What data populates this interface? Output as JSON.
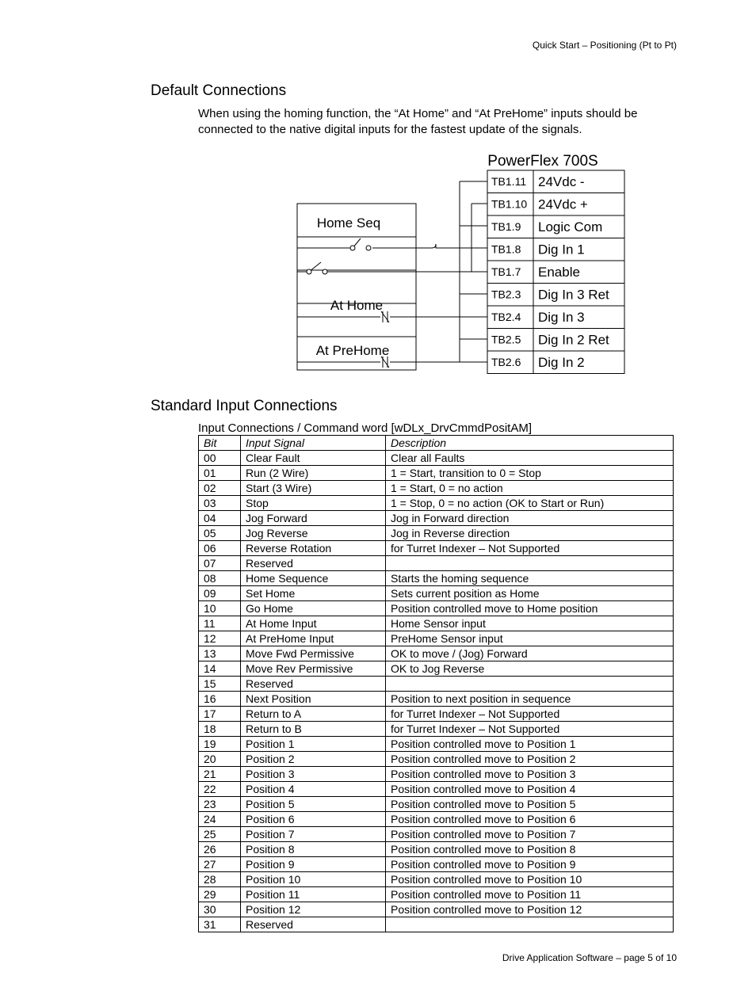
{
  "header": {
    "right": "Quick Start – Positioning (Pt to Pt)"
  },
  "sections": {
    "default_connections": "Default Connections",
    "standard_input": "Standard Input Connections"
  },
  "intro": "When using the homing function, the “At Home” and “At PreHome” inputs should be connected to the native digital inputs for the fastest update of the signals.",
  "diagram": {
    "title": "PowerFlex 700S",
    "labels": {
      "home_seq": "Home Seq",
      "at_home": "At Home",
      "at_prehome": "At PreHome"
    },
    "terminals": [
      {
        "code": "TB1.11",
        "name": "24Vdc -"
      },
      {
        "code": "TB1.10",
        "name": "24Vdc +"
      },
      {
        "code": "TB1.9",
        "name": "Logic Com"
      },
      {
        "code": "TB1.8",
        "name": "Dig In 1"
      },
      {
        "code": "TB1.7",
        "name": "Enable"
      },
      {
        "code": "TB2.3",
        "name": "Dig In 3 Ret"
      },
      {
        "code": "TB2.4",
        "name": "Dig In 3"
      },
      {
        "code": "TB2.5",
        "name": "Dig In 2 Ret"
      },
      {
        "code": "TB2.6",
        "name": "Dig In 2"
      }
    ]
  },
  "table": {
    "caption": "Input Connections / Command word [wDLx_DrvCmmdPositAM]",
    "headers": {
      "bit": "Bit",
      "signal": "Input Signal",
      "desc": "Description"
    },
    "rows": [
      {
        "bit": "00",
        "signal": "Clear Fault",
        "desc": "Clear all Faults"
      },
      {
        "bit": "01",
        "signal": "Run (2 Wire)",
        "desc": "1 = Start, transition to 0 = Stop"
      },
      {
        "bit": "02",
        "signal": "Start (3 Wire)",
        "desc": "1 = Start, 0 = no action"
      },
      {
        "bit": "03",
        "signal": "Stop",
        "desc": "1 = Stop, 0 = no action (OK to Start or Run)"
      },
      {
        "bit": "04",
        "signal": "Jog Forward",
        "desc": "Jog in Forward direction"
      },
      {
        "bit": "05",
        "signal": "Jog Reverse",
        "desc": "Jog in Reverse direction"
      },
      {
        "bit": "06",
        "signal": "Reverse Rotation",
        "desc": "for Turret Indexer – Not Supported"
      },
      {
        "bit": "07",
        "signal": "Reserved",
        "desc": ""
      },
      {
        "bit": "08",
        "signal": "Home Sequence",
        "desc": "Starts the homing sequence"
      },
      {
        "bit": "09",
        "signal": "Set Home",
        "desc": "Sets current position as Home"
      },
      {
        "bit": "10",
        "signal": "Go Home",
        "desc": "Position controlled move to Home position"
      },
      {
        "bit": "11",
        "signal": "At Home Input",
        "desc": "Home Sensor input"
      },
      {
        "bit": "12",
        "signal": "At PreHome Input",
        "desc": "PreHome Sensor input"
      },
      {
        "bit": "13",
        "signal": "Move Fwd Permissive",
        "desc": "OK to move / (Jog) Forward"
      },
      {
        "bit": "14",
        "signal": "Move Rev Permissive",
        "desc": "OK to Jog Reverse"
      },
      {
        "bit": "15",
        "signal": "Reserved",
        "desc": ""
      },
      {
        "bit": "16",
        "signal": "Next Position",
        "desc": "Position to next position in sequence"
      },
      {
        "bit": "17",
        "signal": "Return to A",
        "desc": "for Turret Indexer – Not Supported"
      },
      {
        "bit": "18",
        "signal": "Return to B",
        "desc": "for Turret Indexer – Not Supported"
      },
      {
        "bit": "19",
        "signal": "Position 1",
        "desc": "Position controlled move to Position 1"
      },
      {
        "bit": "20",
        "signal": "Position 2",
        "desc": "Position controlled move to Position 2"
      },
      {
        "bit": "21",
        "signal": "Position 3",
        "desc": "Position controlled move to Position 3"
      },
      {
        "bit": "22",
        "signal": "Position 4",
        "desc": "Position controlled move to Position 4"
      },
      {
        "bit": "23",
        "signal": "Position 5",
        "desc": "Position controlled move to Position 5"
      },
      {
        "bit": "24",
        "signal": "Position 6",
        "desc": "Position controlled move to Position 6"
      },
      {
        "bit": "25",
        "signal": "Position 7",
        "desc": "Position controlled move to Position 7"
      },
      {
        "bit": "26",
        "signal": "Position 8",
        "desc": "Position controlled move to Position 8"
      },
      {
        "bit": "27",
        "signal": "Position 9",
        "desc": "Position controlled move to Position 9"
      },
      {
        "bit": "28",
        "signal": "Position 10",
        "desc": "Position controlled move to Position 10"
      },
      {
        "bit": "29",
        "signal": "Position 11",
        "desc": "Position controlled move to Position 11"
      },
      {
        "bit": "30",
        "signal": "Position 12",
        "desc": "Position controlled move to Position 12"
      },
      {
        "bit": "31",
        "signal": "Reserved",
        "desc": ""
      }
    ]
  },
  "footer": "Drive Application Software – page 5 of 10"
}
